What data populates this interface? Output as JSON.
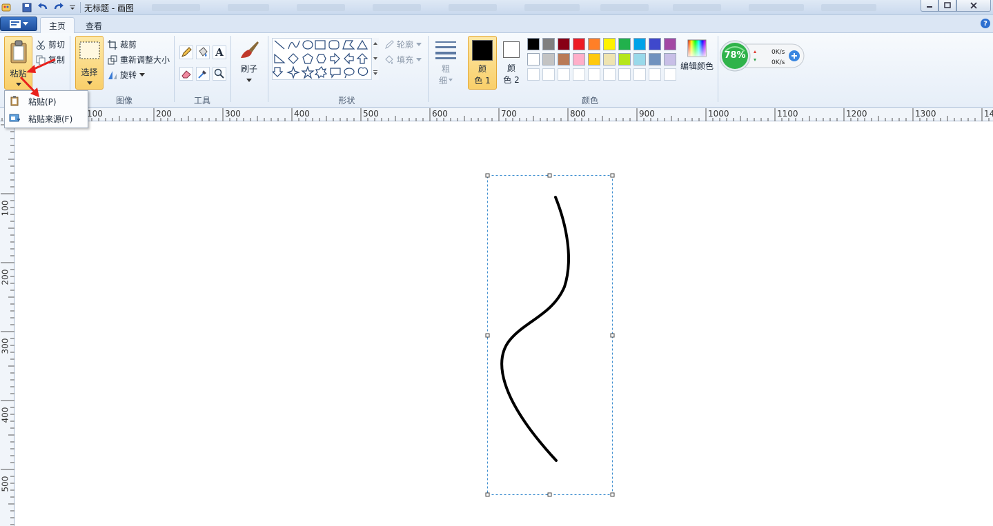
{
  "window": {
    "title": "无标题 - 画图"
  },
  "tabs": {
    "home": "主页",
    "view": "查看"
  },
  "clipboard": {
    "paste": "粘贴",
    "cut": "剪切",
    "copy": "复制"
  },
  "image_group": {
    "label": "图像",
    "select": "选择",
    "crop": "裁剪",
    "resize": "重新调整大小",
    "rotate": "旋转"
  },
  "tools_group": {
    "label": "工具"
  },
  "brushes": {
    "label": "刷子"
  },
  "shapes_group": {
    "label": "形状",
    "outline": "轮廓",
    "fill": "填充"
  },
  "size": {
    "label_top": "粗",
    "label_bottom": "细"
  },
  "colors_group": {
    "label": "颜色",
    "color1_top": "颜",
    "color1_bottom": "色 1",
    "color2_top": "颜",
    "color2_bottom": "色 2",
    "edit": "编辑颜色",
    "color1_value": "#000000",
    "color2_value": "#ffffff",
    "palette_row1": [
      "#000000",
      "#7f7f7f",
      "#880015",
      "#ed1c24",
      "#ff7f27",
      "#fff200",
      "#22b14c",
      "#00a2e8",
      "#3f48cc",
      "#a349a4"
    ],
    "palette_row2": [
      "#ffffff",
      "#c3c3c3",
      "#b97a57",
      "#ffaec9",
      "#ffc90e",
      "#efe4b0",
      "#b5e61d",
      "#99d9ea",
      "#7092be",
      "#c8bfe7"
    ]
  },
  "net_widget": {
    "percent": "78%",
    "upload": "0K/s",
    "download": "0K/s"
  },
  "paste_menu": {
    "paste": "粘贴(P)",
    "paste_from": "粘贴来源(F)"
  },
  "ruler": {
    "h_labels": [
      "100",
      "200",
      "300",
      "400",
      "500",
      "600",
      "700",
      "800",
      "900",
      "1000",
      "1100",
      "1200",
      "1300",
      "14"
    ],
    "v_labels": [
      "100",
      "200",
      "300",
      "400",
      "500"
    ]
  },
  "theme": {
    "accent": "#2d6fd0",
    "hover": "#f9cf6a",
    "selection": "#3f8fd0"
  }
}
